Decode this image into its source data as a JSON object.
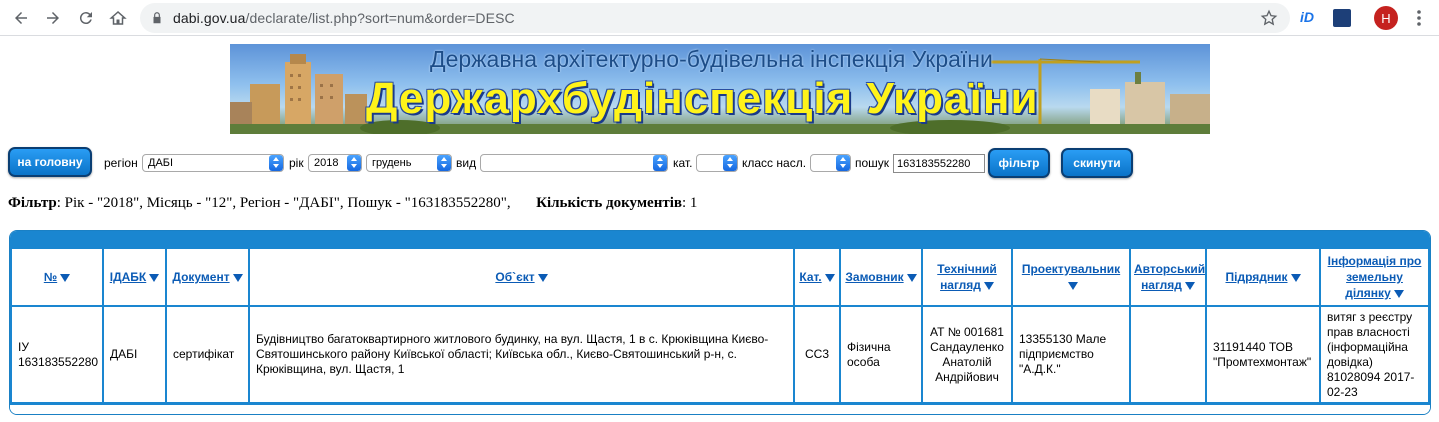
{
  "browser": {
    "url_host": "dabi.gov.ua",
    "url_path": "/declarate/list.php?sort=num&order=DESC",
    "extension_1": "iD",
    "avatar_letter": "H"
  },
  "banner": {
    "subtitle": "Державна архітектурно-будівельна інспекція України",
    "title": "Держархбудінспекція України"
  },
  "filters": {
    "home_button": "на головну",
    "region_label": "регіон",
    "region_value": "ДАБІ",
    "year_label": "рік",
    "year_value": "2018",
    "month_value": "грудень",
    "type_label": "вид",
    "type_value": "",
    "category_label": "кат.",
    "category_value": "",
    "consequence_label": "класс насл.",
    "consequence_value": "",
    "search_label": "пошук",
    "search_value": "163183552280",
    "filter_button": "фільтр",
    "reset_button": "скинути"
  },
  "summary": {
    "filter_label": "Фільтр",
    "filter_text": ": Рік - \"2018\", Місяць - \"12\", Регіон - \"ДАБІ\", Пошук - \"163183552280\",",
    "count_label": "Кількість документів",
    "count_value": ": 1"
  },
  "table": {
    "headers": {
      "num": "№",
      "idabk": "ІДАБК",
      "document": "Документ",
      "object": "Об`єкт",
      "category": "Кат.",
      "customer": "Замовник",
      "tech_supervision": "Технічний нагляд",
      "designer": "Проектувальник",
      "author_supervision": "Авторський нагляд",
      "contractor": "Підрядник",
      "land_info": "Інформація про земельну ділянку"
    },
    "rows": [
      {
        "num": "ІУ 163183552280",
        "idabk": "ДАБІ",
        "document": "сертифікат",
        "object": "Будівництво багатоквартирного житлового будинку, на вул. Щастя, 1 в с. Крюківщина Києво-Святошинського району Київської області; Київська обл., Києво-Святошинський р-н, с. Крюківщина, вул. Щастя, 1",
        "category": "СС3",
        "customer": "Фізична особа",
        "tech_supervision": "АТ № 001681 Сандауленко Анатолій Андрійович",
        "designer": "13355130 Мале підприємство \"А.Д.К.\"",
        "author_supervision": "",
        "contractor": "31191440 ТОВ \"Промтехмонтаж\"",
        "land_info": "витяг з реєстру прав власності (інформаційна довідка) 81028094 2017-02-23"
      }
    ]
  }
}
